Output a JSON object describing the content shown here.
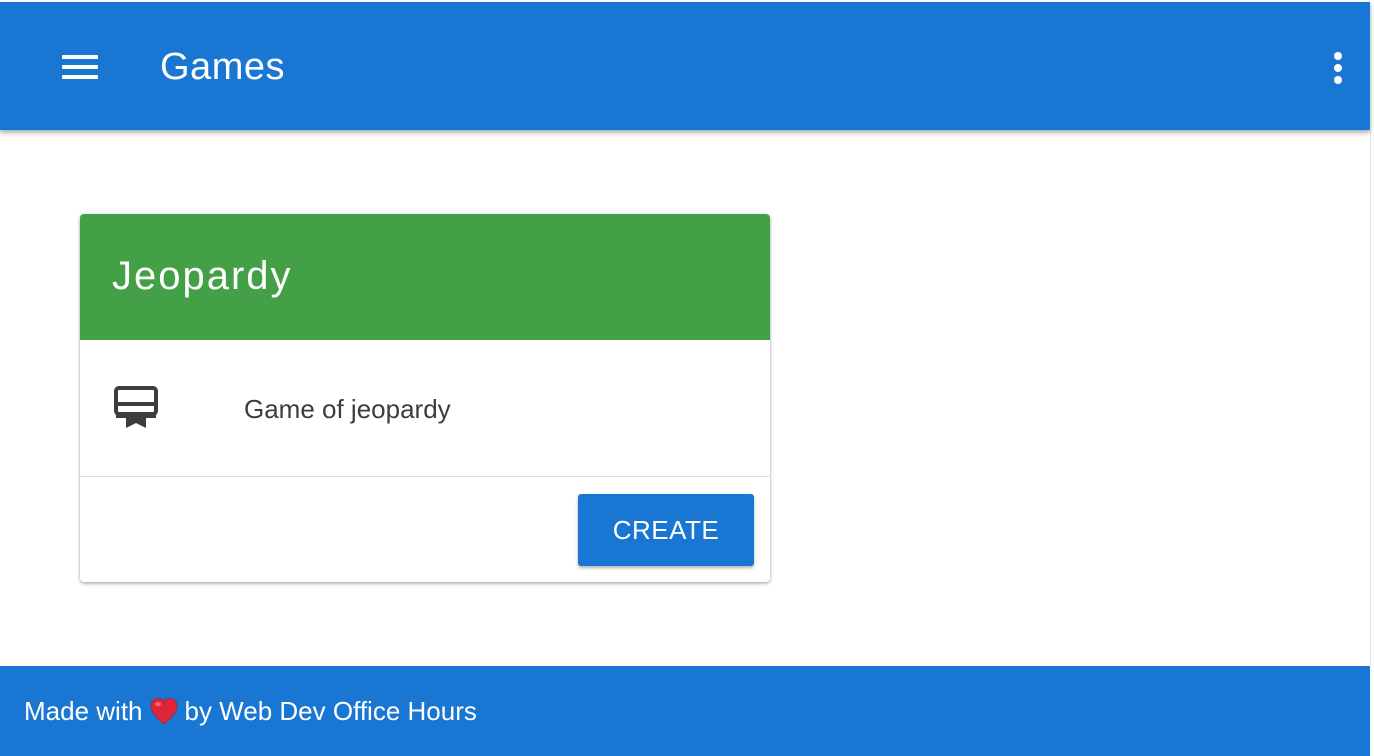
{
  "appbar": {
    "title": "Games",
    "menu_icon": "menu-icon",
    "more_icon": "more-vert-icon"
  },
  "card": {
    "title": "Jeopardy",
    "description": "Game of jeopardy",
    "icon": "card-membership-icon",
    "button_label": "CREATE"
  },
  "footer": {
    "prefix": "Made with",
    "heart_icon": "heart-icon",
    "suffix": "by Web Dev Office Hours"
  },
  "colors": {
    "primary": "#1976d2",
    "card_header": "#43a047",
    "heart": "#e0253b"
  }
}
